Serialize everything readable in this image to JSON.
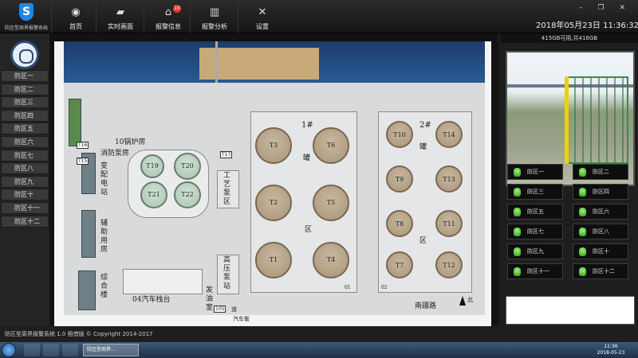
{
  "app": {
    "logo_text": "S",
    "title": "防区型周界报警系统"
  },
  "nav": [
    {
      "label": "首页",
      "icon": "globe-icon"
    },
    {
      "label": "实时画面",
      "icon": "cctv-camera-icon"
    },
    {
      "label": "报警信息",
      "icon": "alarm-info-icon",
      "badge": "10"
    },
    {
      "label": "报警分析",
      "icon": "bar-chart-icon"
    },
    {
      "label": "设置",
      "icon": "wrench-screwdriver-icon"
    }
  ],
  "datetime": "2018年05月23日  11:36:32",
  "window_controls": "– ❐ ✕",
  "sidebar": {
    "zones": [
      "防区一",
      "防区二",
      "防区三",
      "防区四",
      "防区五",
      "防区六",
      "防区七",
      "防区八",
      "防区九",
      "防区十",
      "防区十一",
      "防区十二"
    ]
  },
  "map": {
    "tanks_block1": [
      "T3",
      "T6",
      "T2",
      "T5",
      "T1",
      "T4"
    ],
    "tanks_block2": [
      "T10",
      "T14",
      "T9",
      "T13",
      "T8",
      "T11",
      "T7",
      "T12"
    ],
    "tanks_green": [
      "T19",
      "T20",
      "T21",
      "T22"
    ],
    "labels": {
      "boiler": "10锅炉房",
      "fire_pump": "消防泵房",
      "substation": "变配电站",
      "aux_room": "辅助用房",
      "complex": "综合楼",
      "process_pump": "工艺泵区",
      "hp_pump": "高压泵站",
      "truck_loading": "04汽车栈台",
      "generator": "发油室",
      "block1_a": "1#",
      "block1_b": "罐",
      "block1_c": "区",
      "block2_a": "2#",
      "block2_b": "罐",
      "block2_c": "区",
      "road": "南疆路",
      "north": "北",
      "gate": "道",
      "wash": "汽车衡",
      "t16": "T16",
      "t17": "T17",
      "t15": "T15",
      "c105": "105",
      "b01": "01",
      "b02": "02",
      "red_tag": "北门"
    }
  },
  "right": {
    "disk": "415GB可用,共416GB",
    "zones": [
      "防区一",
      "防区二",
      "防区三",
      "防区四",
      "防区五",
      "防区六",
      "防区七",
      "防区八",
      "防区九",
      "防区十",
      "防区十一",
      "防区十二"
    ],
    "status_color": "#3cb81e"
  },
  "footer": {
    "text": "防区型周界报警系统 1.0  租借版  © Copyright 2014-2017"
  },
  "taskbar": {
    "active_item": "防区型周界...",
    "time": "11:36",
    "date": "2018-05-23"
  }
}
